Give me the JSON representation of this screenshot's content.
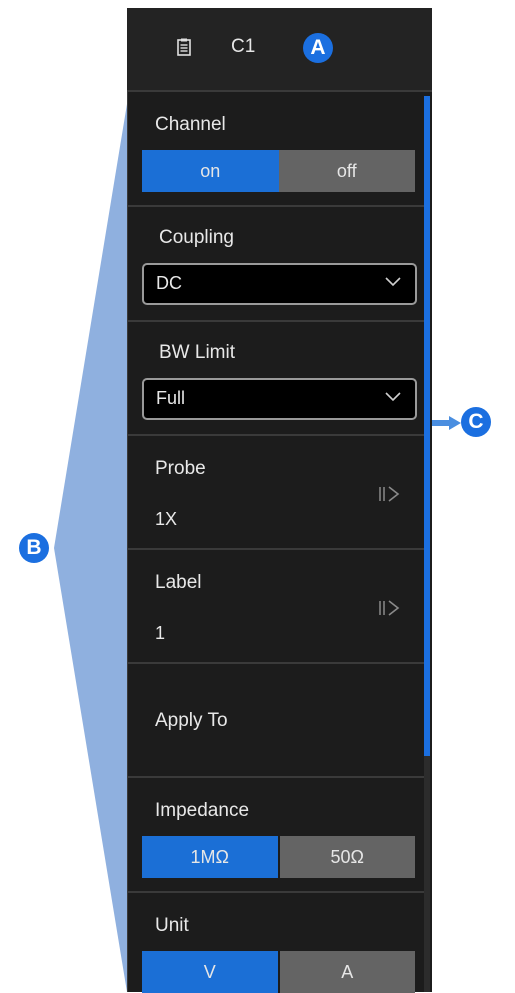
{
  "header": {
    "title": "C1",
    "icon": "clipboard-icon"
  },
  "callouts": {
    "a": "A",
    "b": "B",
    "c": "C"
  },
  "channel": {
    "label": "Channel",
    "on": "on",
    "off": "off"
  },
  "coupling": {
    "label": "Coupling",
    "value": "DC"
  },
  "bw_limit": {
    "label": "BW Limit",
    "value": "Full"
  },
  "probe": {
    "label": "Probe",
    "value": "1X"
  },
  "label_item": {
    "label": "Label",
    "value": "1"
  },
  "apply_to": {
    "label": "Apply To"
  },
  "impedance": {
    "label": "Impedance",
    "opt1": "1MΩ",
    "opt2": "50Ω"
  },
  "unit": {
    "label": "Unit",
    "opt1": "V",
    "opt2": "A"
  },
  "colors": {
    "accent": "#1b6fe0",
    "panel_bg": "#1c1c1c",
    "inactive": "#646464",
    "bracket": "#8fb0df"
  }
}
